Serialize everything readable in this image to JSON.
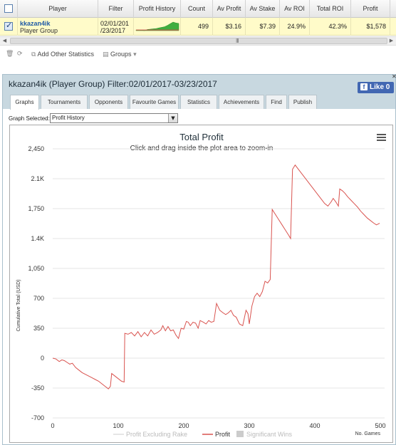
{
  "grid": {
    "headers": [
      "Player",
      "Filter",
      "Profit History",
      "Count",
      "Av Profit",
      "Av Stake",
      "Av ROI",
      "Total ROI",
      "Profit"
    ],
    "row": {
      "checked": true,
      "player_name": "kkazan4ik",
      "player_group": "Player Group",
      "filter_line1": "02/01/201",
      "filter_line2": "/23/2017",
      "count": "499",
      "av_profit": "$3.16",
      "av_stake": "$7.39",
      "av_roi": "24.9%",
      "total_roi": "42.3%",
      "profit": "$1,578"
    },
    "scroll_grip": "III"
  },
  "toolbar": {
    "add_stats_label": "Add Other Statistics",
    "groups_label": "Groups"
  },
  "panel": {
    "title": "kkazan4ik (Player Group) Filter:02/01/2017-03/23/2017",
    "like_label": "Like 0",
    "like_icon": "f",
    "tabs": [
      "Graphs",
      "Tournaments",
      "Opponents",
      "Favourite Games",
      "Statistics",
      "Achievements",
      "Find",
      "Publish"
    ],
    "active_tab": "Graphs",
    "graph_selected_label": "Graph Selected:",
    "graph_selected_value": "Profit History"
  },
  "chart_data": {
    "type": "line",
    "title": "Total Profit",
    "subtitle": "Click and drag inside the plot area to zoom-in",
    "xlabel": "No. Games",
    "ylabel": "Cumulative Total (USD)",
    "xlim": [
      0,
      500
    ],
    "ylim": [
      -700,
      2450
    ],
    "x_ticks": [
      "0",
      "100",
      "200",
      "300",
      "400",
      "500"
    ],
    "y_ticks": [
      "2,450",
      "2.1K",
      "1,750",
      "1.4K",
      "1,050",
      "700",
      "350",
      "0",
      "-350",
      "-700"
    ],
    "y_tick_values": [
      2450,
      2100,
      1750,
      1400,
      1050,
      700,
      350,
      0,
      -350,
      -700
    ],
    "legend": [
      "Profit Excluding Rake",
      "Profit",
      "Significant Wins"
    ],
    "legend_placement": "bottom",
    "line_color": "#d9534f",
    "series": [
      {
        "name": "Profit",
        "points": [
          [
            0,
            0
          ],
          [
            5,
            -10
          ],
          [
            10,
            -40
          ],
          [
            14,
            -20
          ],
          [
            18,
            -30
          ],
          [
            22,
            -50
          ],
          [
            26,
            -70
          ],
          [
            30,
            -60
          ],
          [
            35,
            -110
          ],
          [
            40,
            -140
          ],
          [
            45,
            -170
          ],
          [
            50,
            -190
          ],
          [
            55,
            -210
          ],
          [
            60,
            -230
          ],
          [
            65,
            -250
          ],
          [
            70,
            -270
          ],
          [
            75,
            -300
          ],
          [
            80,
            -330
          ],
          [
            85,
            -360
          ],
          [
            88,
            -330
          ],
          [
            90,
            -180
          ],
          [
            95,
            -210
          ],
          [
            100,
            -240
          ],
          [
            105,
            -270
          ],
          [
            109,
            -280
          ],
          [
            110,
            290
          ],
          [
            115,
            280
          ],
          [
            120,
            300
          ],
          [
            125,
            260
          ],
          [
            130,
            310
          ],
          [
            135,
            250
          ],
          [
            140,
            300
          ],
          [
            145,
            260
          ],
          [
            150,
            330
          ],
          [
            155,
            280
          ],
          [
            160,
            300
          ],
          [
            165,
            330
          ],
          [
            168,
            380
          ],
          [
            172,
            320
          ],
          [
            176,
            370
          ],
          [
            180,
            320
          ],
          [
            184,
            330
          ],
          [
            188,
            270
          ],
          [
            192,
            230
          ],
          [
            196,
            350
          ],
          [
            200,
            340
          ],
          [
            204,
            430
          ],
          [
            207,
            420
          ],
          [
            210,
            380
          ],
          [
            214,
            420
          ],
          [
            218,
            410
          ],
          [
            222,
            350
          ],
          [
            225,
            440
          ],
          [
            230,
            420
          ],
          [
            234,
            400
          ],
          [
            238,
            440
          ],
          [
            242,
            420
          ],
          [
            246,
            430
          ],
          [
            250,
            640
          ],
          [
            255,
            560
          ],
          [
            260,
            530
          ],
          [
            264,
            510
          ],
          [
            268,
            530
          ],
          [
            272,
            560
          ],
          [
            276,
            500
          ],
          [
            280,
            480
          ],
          [
            285,
            400
          ],
          [
            290,
            380
          ],
          [
            295,
            560
          ],
          [
            298,
            520
          ],
          [
            300,
            400
          ],
          [
            304,
            610
          ],
          [
            308,
            720
          ],
          [
            312,
            760
          ],
          [
            316,
            720
          ],
          [
            320,
            780
          ],
          [
            324,
            900
          ],
          [
            328,
            880
          ],
          [
            332,
            920
          ],
          [
            335,
            1740
          ],
          [
            340,
            1680
          ],
          [
            345,
            1620
          ],
          [
            350,
            1560
          ],
          [
            355,
            1500
          ],
          [
            360,
            1440
          ],
          [
            363,
            1400
          ],
          [
            366,
            2210
          ],
          [
            370,
            2260
          ],
          [
            375,
            2210
          ],
          [
            380,
            2160
          ],
          [
            385,
            2110
          ],
          [
            390,
            2060
          ],
          [
            395,
            2010
          ],
          [
            400,
            1960
          ],
          [
            405,
            1910
          ],
          [
            410,
            1860
          ],
          [
            415,
            1810
          ],
          [
            420,
            1780
          ],
          [
            425,
            1830
          ],
          [
            428,
            1870
          ],
          [
            432,
            1830
          ],
          [
            436,
            1780
          ],
          [
            438,
            1980
          ],
          [
            442,
            1960
          ],
          [
            446,
            1930
          ],
          [
            450,
            1890
          ],
          [
            455,
            1850
          ],
          [
            460,
            1810
          ],
          [
            465,
            1770
          ],
          [
            470,
            1720
          ],
          [
            475,
            1680
          ],
          [
            480,
            1640
          ],
          [
            485,
            1610
          ],
          [
            490,
            1580
          ],
          [
            494,
            1560
          ],
          [
            499,
            1578
          ]
        ]
      }
    ],
    "sparkline": [
      0,
      -20,
      -80,
      -150,
      120,
      200,
      280,
      320,
      500,
      640,
      780,
      1100,
      1500,
      1900,
      1700,
      1578
    ]
  }
}
